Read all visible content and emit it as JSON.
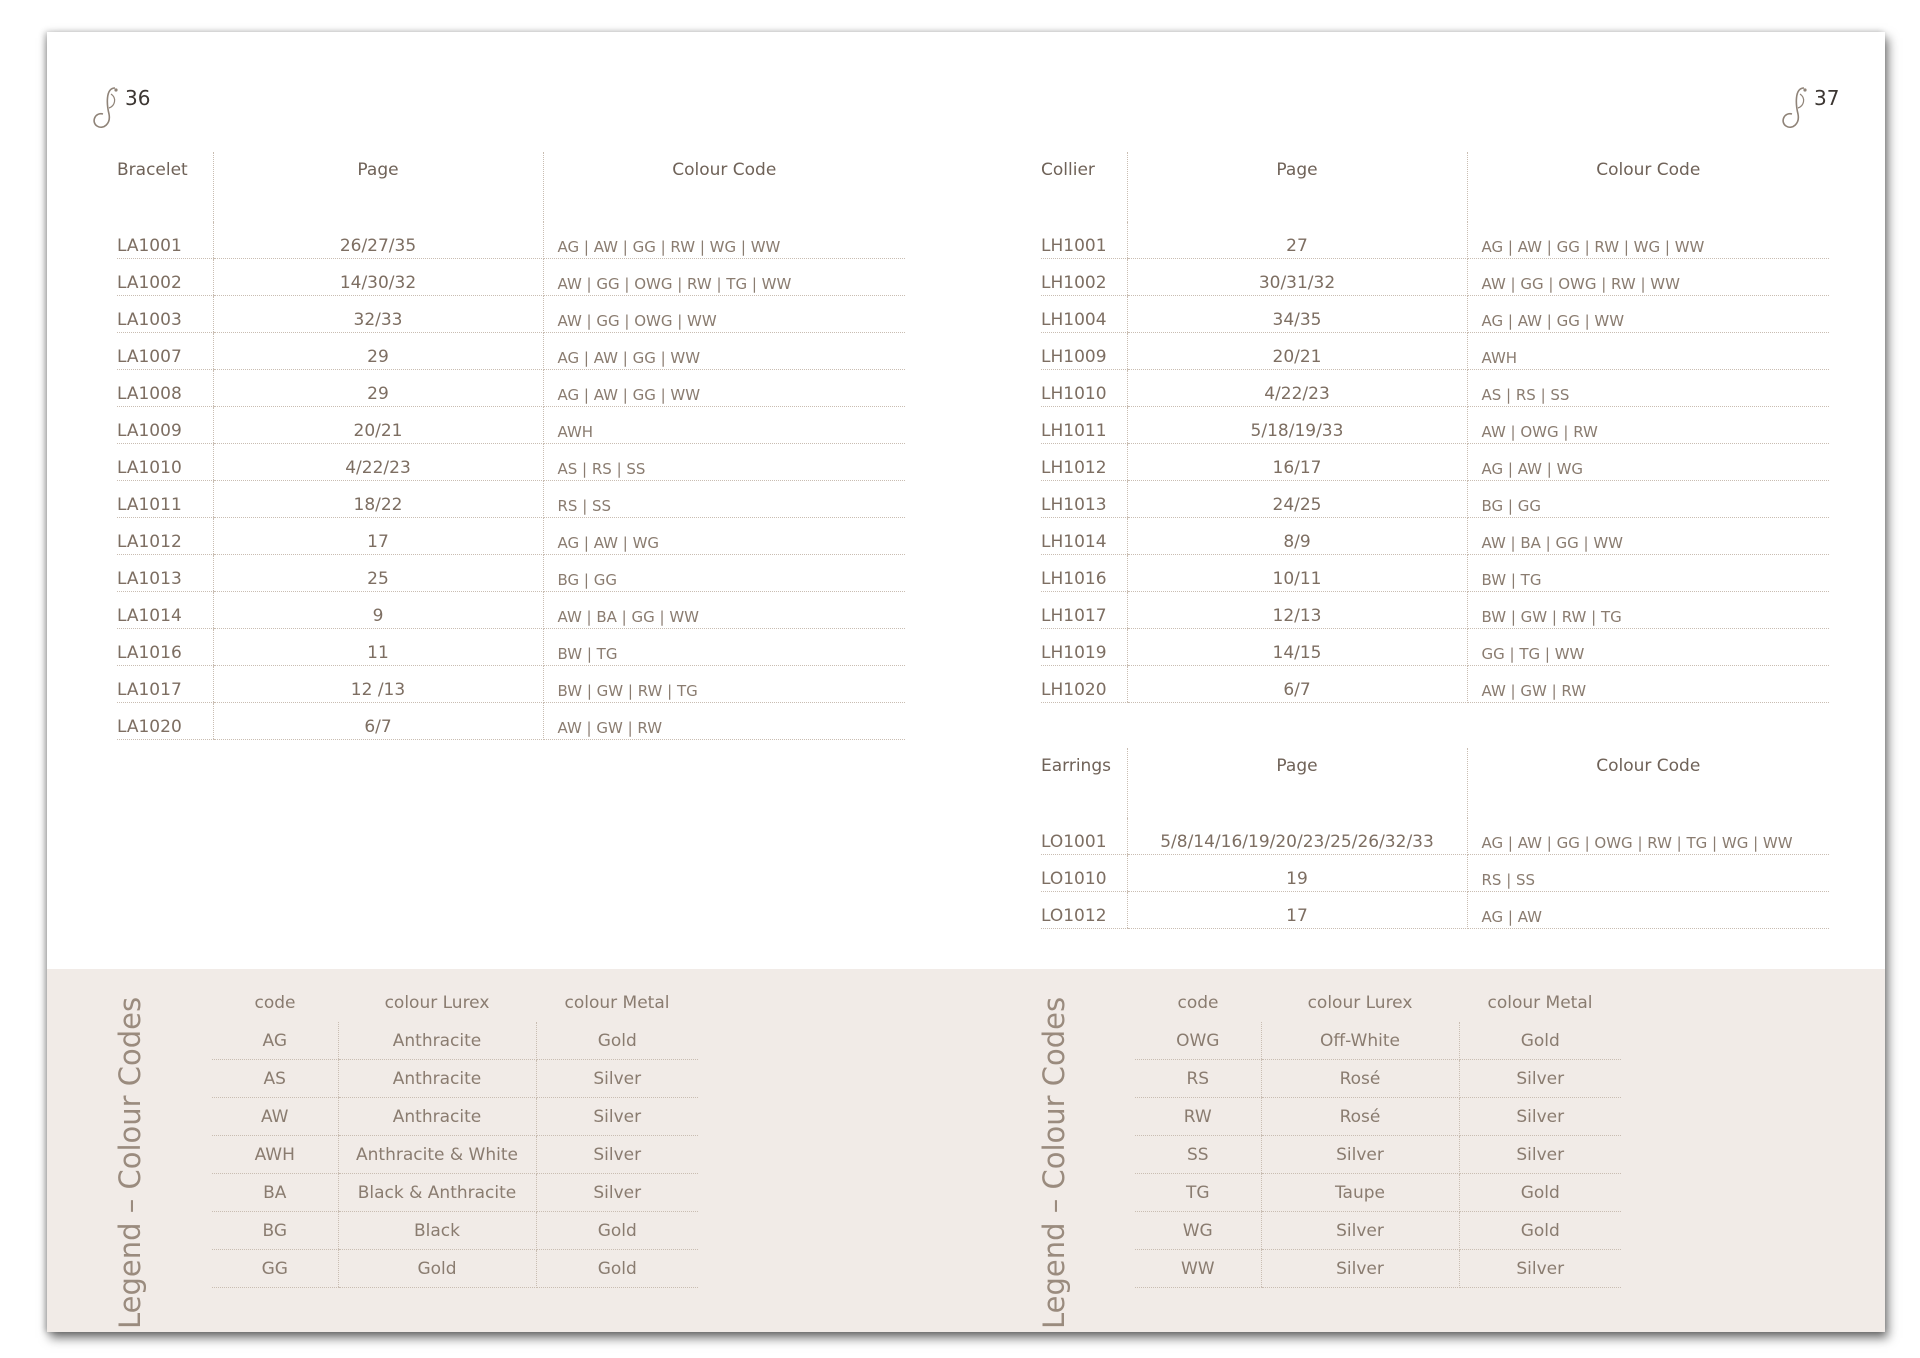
{
  "left_page": {
    "page_number": "36",
    "bracelet": {
      "headers": [
        "Bracelet",
        "Page",
        "Colour Code"
      ],
      "rows": [
        [
          "LA1001",
          "26/27/35",
          "AG | AW | GG | RW | WG | WW"
        ],
        [
          "LA1002",
          "14/30/32",
          "AW | GG | OWG | RW | TG | WW"
        ],
        [
          "LA1003",
          "32/33",
          "AW | GG | OWG | WW"
        ],
        [
          "LA1007",
          "29",
          "AG | AW | GG | WW"
        ],
        [
          "LA1008",
          "29",
          "AG | AW | GG | WW"
        ],
        [
          "LA1009",
          "20/21",
          "AWH"
        ],
        [
          "LA1010",
          "4/22/23",
          "AS | RS | SS"
        ],
        [
          "LA1011",
          "18/22",
          "RS | SS"
        ],
        [
          "LA1012",
          "17",
          "AG | AW | WG"
        ],
        [
          "LA1013",
          "25",
          "BG | GG"
        ],
        [
          "LA1014",
          "9",
          "AW | BA | GG | WW"
        ],
        [
          "LA1016",
          "11",
          "BW | TG"
        ],
        [
          "LA1017",
          "12 /13",
          "BW | GW | RW | TG"
        ],
        [
          "LA1020",
          "6/7",
          "AW | GW | RW"
        ]
      ]
    },
    "legend": {
      "title": "Legend – Colour Codes",
      "headers": [
        "code",
        "colour Lurex",
        "colour Metal"
      ],
      "rows": [
        [
          "AG",
          "Anthracite",
          "Gold"
        ],
        [
          "AS",
          "Anthracite",
          "Silver"
        ],
        [
          "AW",
          "Anthracite",
          "Silver"
        ],
        [
          "AWH",
          "Anthracite & White",
          "Silver"
        ],
        [
          "BA",
          "Black & Anthracite",
          "Silver"
        ],
        [
          "BG",
          "Black",
          "Gold"
        ],
        [
          "GG",
          "Gold",
          "Gold"
        ]
      ]
    }
  },
  "right_page": {
    "page_number": "37",
    "collier": {
      "headers": [
        "Collier",
        "Page",
        "Colour Code"
      ],
      "rows": [
        [
          "LH1001",
          "27",
          "AG | AW | GG | RW | WG | WW"
        ],
        [
          "LH1002",
          "30/31/32",
          "AW | GG | OWG | RW | WW"
        ],
        [
          "LH1004",
          "34/35",
          "AG | AW | GG | WW"
        ],
        [
          "LH1009",
          "20/21",
          "AWH"
        ],
        [
          "LH1010",
          "4/22/23",
          "AS | RS | SS"
        ],
        [
          "LH1011",
          "5/18/19/33",
          "AW | OWG | RW"
        ],
        [
          "LH1012",
          "16/17",
          "AG | AW | WG"
        ],
        [
          "LH1013",
          "24/25",
          "BG | GG"
        ],
        [
          "LH1014",
          "8/9",
          "AW | BA | GG | WW"
        ],
        [
          "LH1016",
          "10/11",
          "BW | TG"
        ],
        [
          "LH1017",
          "12/13",
          "BW | GW | RW | TG"
        ],
        [
          "LH1019",
          "14/15",
          "GG | TG | WW"
        ],
        [
          "LH1020",
          "6/7",
          "AW | GW | RW"
        ]
      ]
    },
    "earrings": {
      "headers": [
        "Earrings",
        "Page",
        "Colour Code"
      ],
      "rows": [
        [
          "LO1001",
          "5/8/14/16/19/20/23/25/26/32/33",
          "AG | AW | GG | OWG | RW | TG | WG | WW"
        ],
        [
          "LO1010",
          "19",
          "RS | SS"
        ],
        [
          "LO1012",
          "17",
          "AG | AW"
        ]
      ]
    },
    "legend": {
      "title": "Legend – Colour Codes",
      "headers": [
        "code",
        "colour Lurex",
        "colour Metal"
      ],
      "rows": [
        [
          "OWG",
          "Off-White",
          "Gold"
        ],
        [
          "RS",
          "Rosé",
          "Silver"
        ],
        [
          "RW",
          "Rosé",
          "Silver"
        ],
        [
          "SS",
          "Silver",
          "Silver"
        ],
        [
          "TG",
          "Taupe",
          "Gold"
        ],
        [
          "WG",
          "Silver",
          "Gold"
        ],
        [
          "WW",
          "Silver",
          "Silver"
        ]
      ]
    }
  },
  "colors": {
    "legend_band": "#f1ebe7",
    "text": "#7d6e62",
    "rule": "#c9bdb2"
  }
}
